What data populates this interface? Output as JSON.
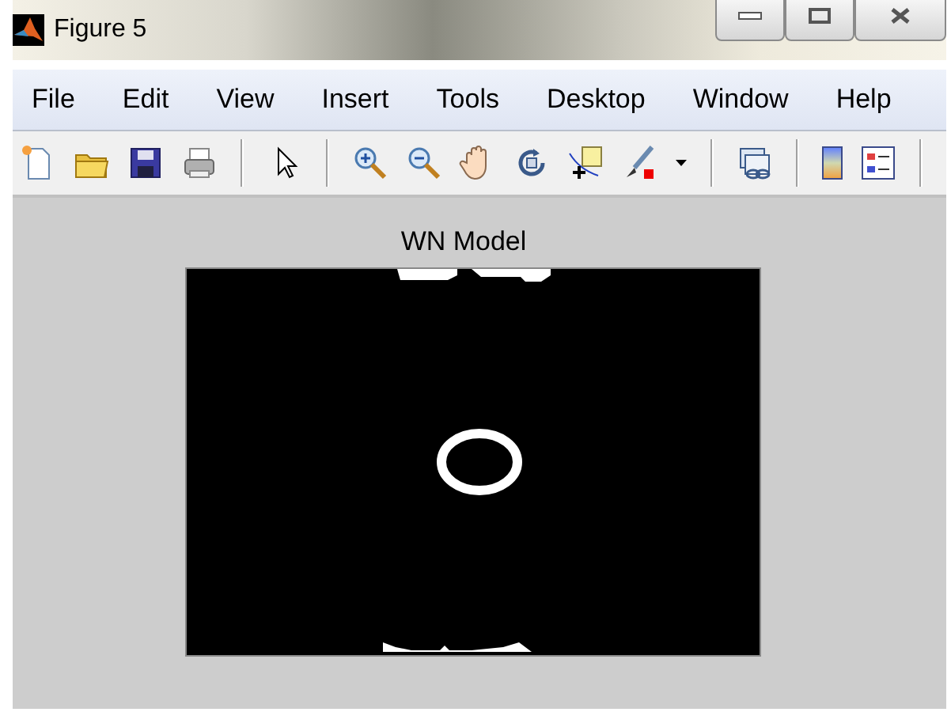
{
  "window": {
    "title": "Figure 5"
  },
  "menu": [
    {
      "label": "File"
    },
    {
      "label": "Edit"
    },
    {
      "label": "View"
    },
    {
      "label": "Insert"
    },
    {
      "label": "Tools"
    },
    {
      "label": "Desktop"
    },
    {
      "label": "Window"
    },
    {
      "label": "Help"
    }
  ],
  "axes": {
    "title": "WN Model"
  }
}
